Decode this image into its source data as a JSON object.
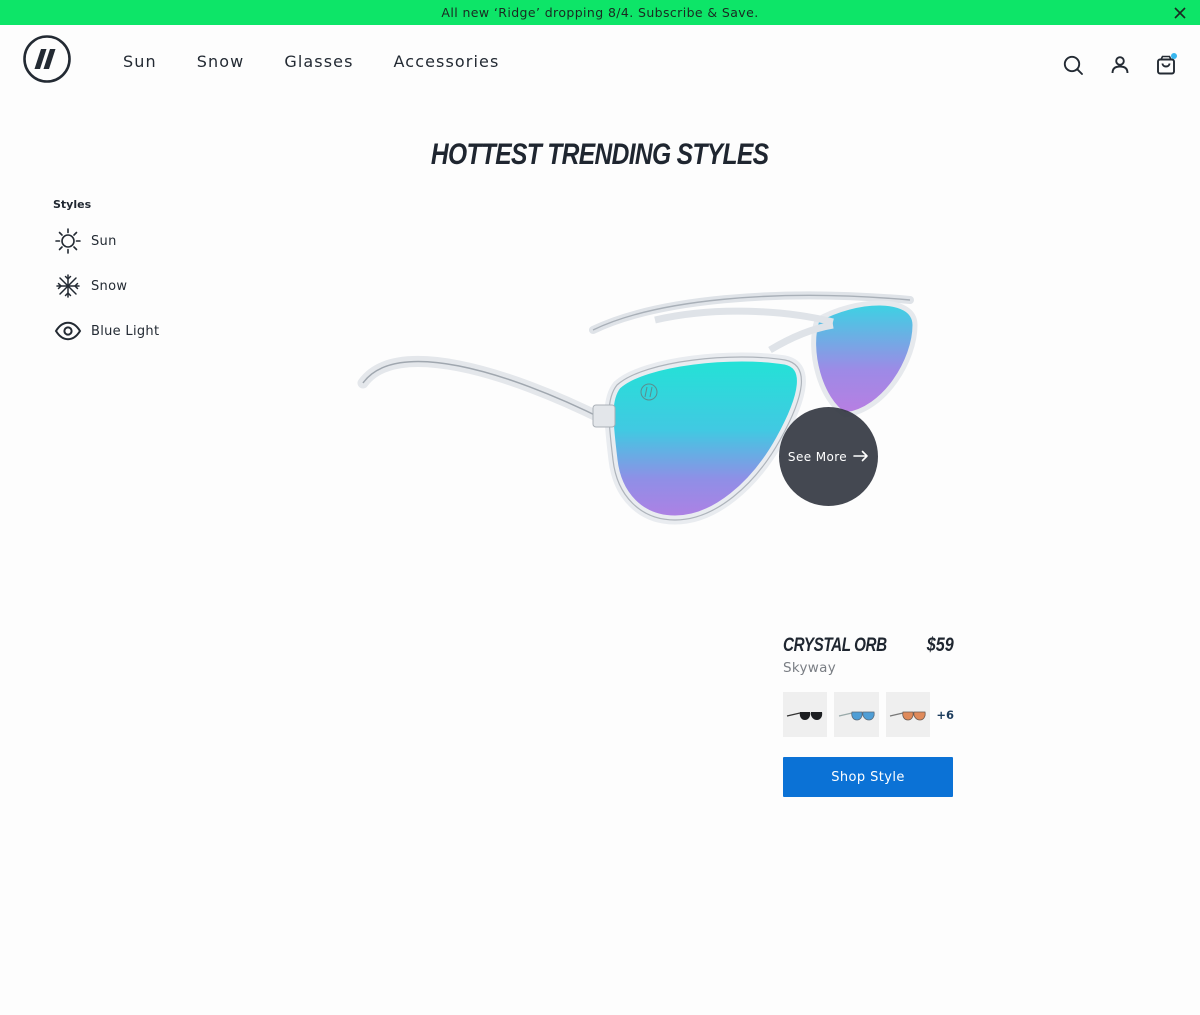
{
  "promo": {
    "text": "All new ‘Ridge’ dropping 8/4. Subscribe & Save.",
    "close_icon": "close-icon"
  },
  "header": {
    "logo_icon": "brand-slash-logo",
    "nav": [
      "Sun",
      "Snow",
      "Glasses",
      "Accessories"
    ],
    "icons": [
      "search-icon",
      "account-icon",
      "cart-icon"
    ],
    "cart_badge_color": "#37b6ef"
  },
  "main": {
    "title": "HOTTEST TRENDING STYLES"
  },
  "sidebar": {
    "heading": "Styles",
    "items": [
      {
        "label": "Sun",
        "icon": "sun-icon"
      },
      {
        "label": "Snow",
        "icon": "snowflake-icon"
      },
      {
        "label": "Blue Light",
        "icon": "eye-icon"
      }
    ]
  },
  "product": {
    "see_more": "See More",
    "name": "CRYSTAL ORB",
    "price": "$59",
    "variant": "Skyway",
    "swatches": [
      "black-lens-sunglasses",
      "blue-lens-sunglasses",
      "orange-lens-sunglasses"
    ],
    "more_count": "+6",
    "cta": "Shop Style"
  },
  "colors": {
    "promo_bg": "#0de568",
    "cta_bg": "#0b72d6",
    "text": "#232a33",
    "see_more_bg": "#343842"
  }
}
